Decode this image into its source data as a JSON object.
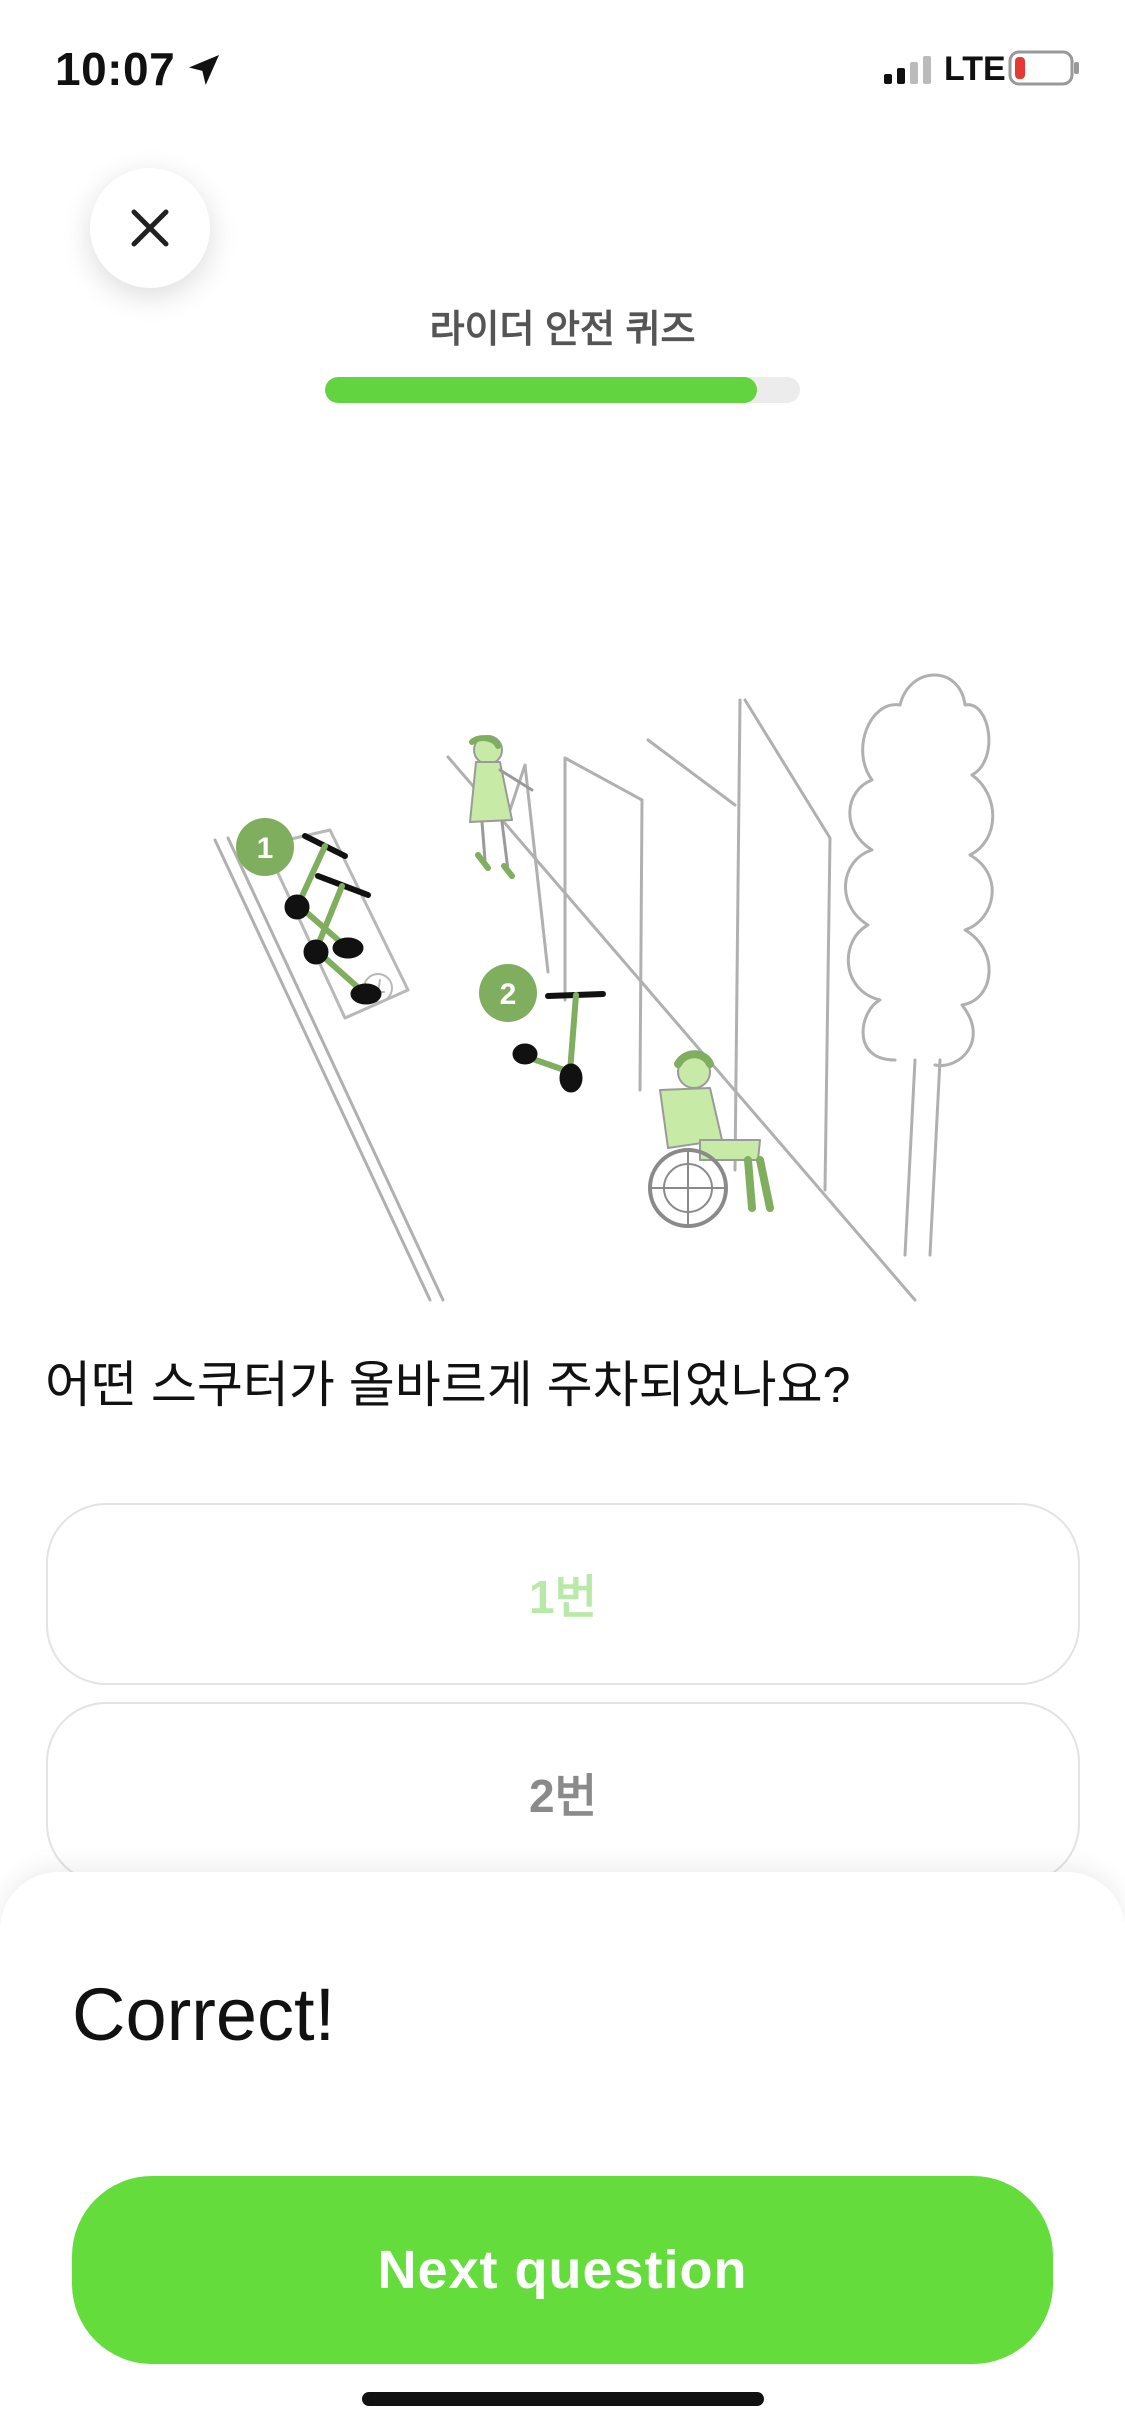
{
  "status_bar": {
    "time": "10:07",
    "network": "LTE",
    "icons": [
      "location-arrow-icon",
      "cellular-signal-icon",
      "battery-low-icon"
    ],
    "battery_color": "#e53935"
  },
  "header": {
    "close_icon": "close-icon",
    "title": "라이더 안전 퀴즈",
    "progress": 0.91
  },
  "illustration": {
    "markers": [
      "1",
      "2"
    ]
  },
  "question": {
    "text": "어떤 스쿠터가 올바르게 주차되었나요?"
  },
  "answers": [
    {
      "label": "1번"
    },
    {
      "label": "2번"
    }
  ],
  "result": {
    "title": "Correct!",
    "next_button": "Next question"
  },
  "colors": {
    "accent": "#64dc3c",
    "marker": "#7faf5e",
    "figure_fill": "#c8eaa7"
  }
}
